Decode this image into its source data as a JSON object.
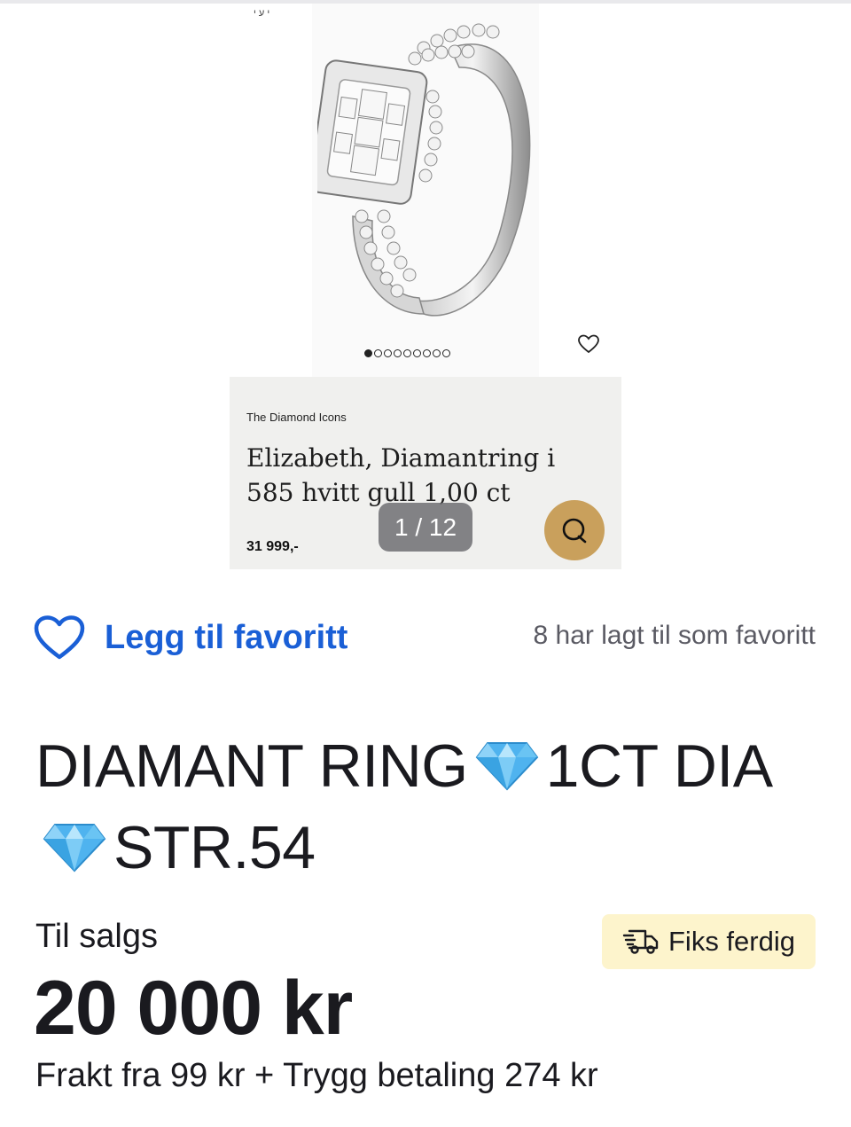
{
  "photo": {
    "caption": "י ע י",
    "carousel_count": 9,
    "carousel_active": 1,
    "heart_icon": "heart-outline-icon"
  },
  "card": {
    "brand": "The Diamond Icons",
    "title": "Elizabeth, Diamantring i 585 hvitt gull 1,00 ct",
    "price": "31 999,-",
    "chat_icon": "chat-bubble-icon",
    "chat_color": "#c9a05c"
  },
  "gallery": {
    "counter": "1 / 12"
  },
  "favorite": {
    "button_label": "Legg til favoritt",
    "count_text": "8 har lagt til som favoritt",
    "icon": "heart-outline-icon",
    "accent": "#1a5fd6"
  },
  "listing": {
    "title_part1": "DIAMANT RING",
    "title_part2": "1CT DIA",
    "title_part3": "STR.54",
    "gem_icon": "gem-icon",
    "status": "Til salgs",
    "badge": {
      "label": "Fiks ferdig",
      "icon": "delivery-truck-icon",
      "color": "#fdf4cc"
    },
    "price": "20 000 kr",
    "shipping": "Frakt fra 99 kr + Trygg betaling 274 kr"
  }
}
